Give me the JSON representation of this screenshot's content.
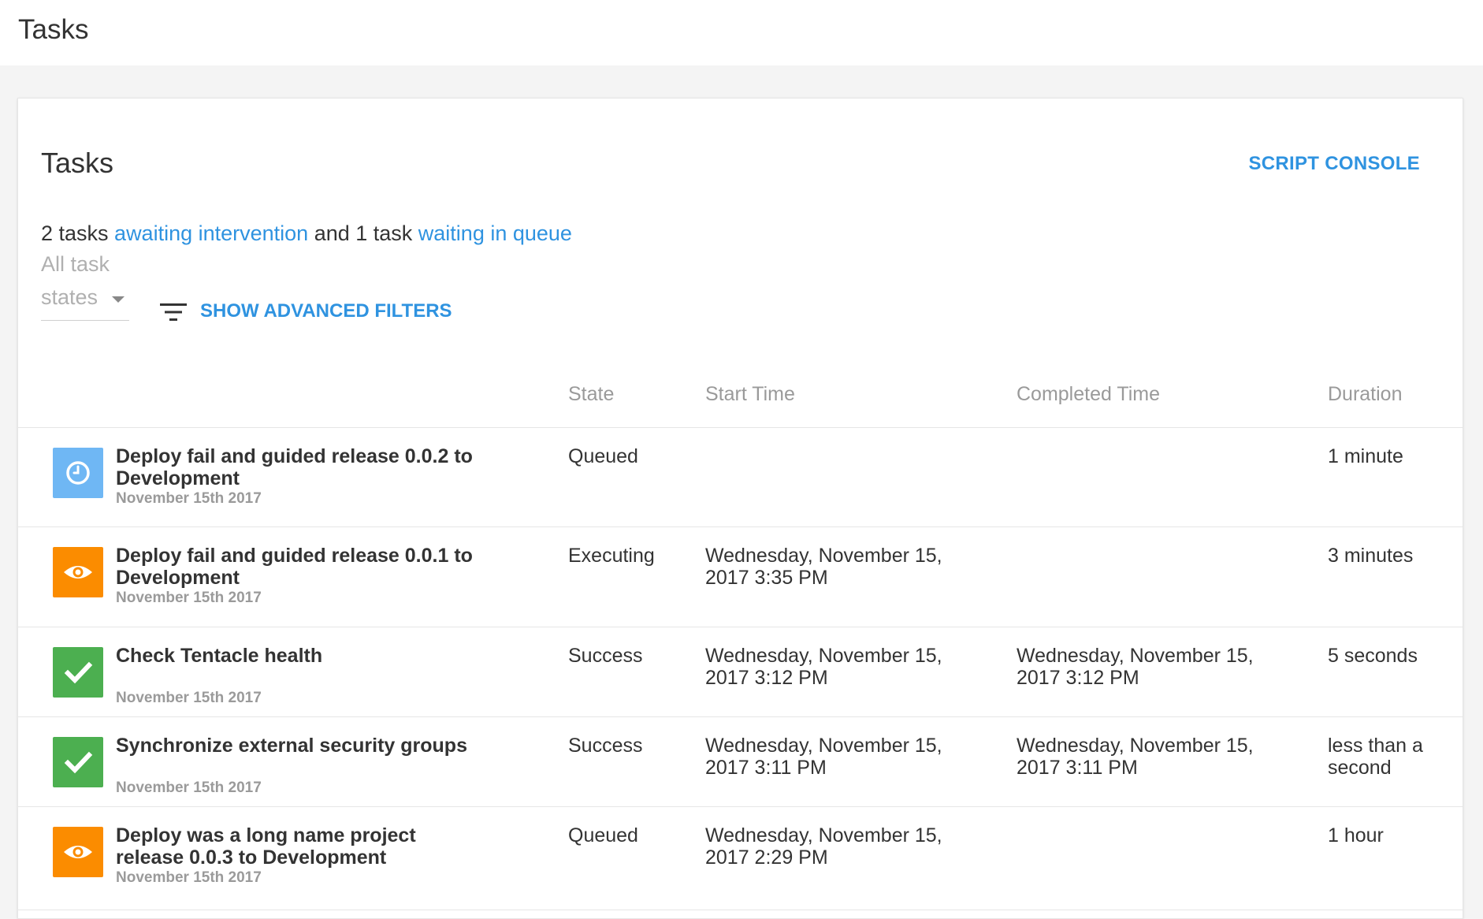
{
  "page": {
    "title": "Tasks"
  },
  "card": {
    "title": "Tasks",
    "script_console_label": "SCRIPT CONSOLE",
    "summary": {
      "part1": "2 tasks ",
      "link1": "awaiting intervention",
      "part2": " and 1 task ",
      "link2": "waiting in queue"
    },
    "state_filter": {
      "line1": "All task",
      "line2": "states"
    },
    "advanced_filters_label": "SHOW ADVANCED FILTERS"
  },
  "table": {
    "columns": {
      "state": "State",
      "start_time": "Start Time",
      "completed_time": "Completed Time",
      "duration": "Duration"
    },
    "rows": [
      {
        "icon": "clock-icon",
        "icon_color": "#6fb7f4",
        "name": "Deploy fail and guided release 0.0.2 to Development",
        "date": "November 15th 2017",
        "state": "Queued",
        "start_time": "",
        "completed_time": "",
        "duration": "1 minute"
      },
      {
        "icon": "eye-icon",
        "icon_color": "#fb8c00",
        "name": "Deploy fail and guided release 0.0.1 to Development",
        "date": "November 15th 2017",
        "state": "Executing",
        "start_time": "Wednesday, November 15, 2017 3:35 PM",
        "completed_time": "",
        "duration": "3 minutes"
      },
      {
        "icon": "check-icon",
        "icon_color": "#4caf50",
        "name": "Check Tentacle health",
        "date": "November 15th 2017",
        "state": "Success",
        "start_time": "Wednesday, November 15, 2017 3:12 PM",
        "completed_time": "Wednesday, November 15, 2017 3:12 PM",
        "duration": "5 seconds"
      },
      {
        "icon": "check-icon",
        "icon_color": "#4caf50",
        "name": "Synchronize external security groups",
        "date": "November 15th 2017",
        "state": "Success",
        "start_time": "Wednesday, November 15, 2017 3:11 PM",
        "completed_time": "Wednesday, November 15, 2017 3:11 PM",
        "duration": "less than a second"
      },
      {
        "icon": "eye-icon",
        "icon_color": "#fb8c00",
        "name": "Deploy was a long name project release 0.0.3 to Development",
        "date": "November 15th 2017",
        "state": "Queued",
        "start_time": "Wednesday, November 15, 2017 2:29 PM",
        "completed_time": "",
        "duration": "1 hour"
      }
    ]
  }
}
